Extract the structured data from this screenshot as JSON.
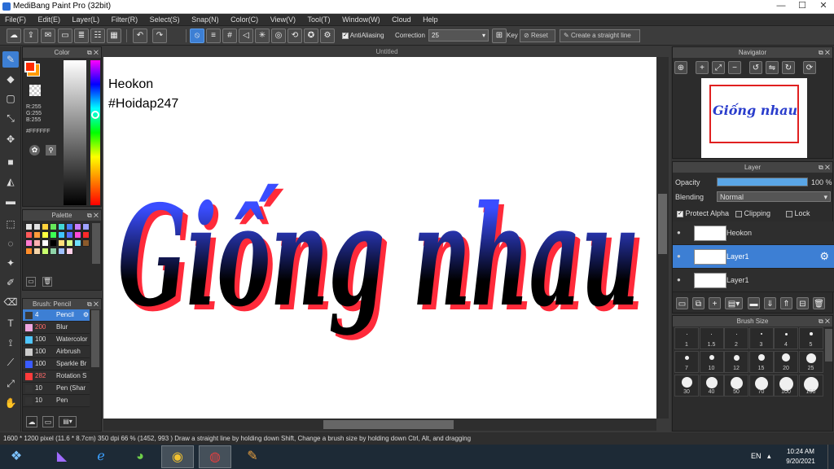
{
  "window": {
    "title": "MediBang Paint Pro (32bit)",
    "minimize": "—",
    "maximize": "☐",
    "close": "✕"
  },
  "menu": [
    "File(F)",
    "Edit(E)",
    "Layer(L)",
    "Filter(R)",
    "Select(S)",
    "Snap(N)",
    "Color(C)",
    "View(V)",
    "Tool(T)",
    "Window(W)",
    "Cloud",
    "Help"
  ],
  "toolbar": {
    "antialiasing_label": "AntiAliasing",
    "correction_label": "Correction",
    "correction_value": "25",
    "key_label": "Key",
    "reset_label": "Reset",
    "straight_line_placeholder": "Create a straight line"
  },
  "color_panel": {
    "title": "Color",
    "r": "R:255",
    "g": "G:255",
    "b": "B:255",
    "hex": "#FFFFFF",
    "primary": "#ff2a00",
    "secondary": "#ff9a00"
  },
  "palette": {
    "title": "Palette",
    "colors": [
      "#e6e6e6",
      "#e0e0e0",
      "#ffd23b",
      "#66e85a",
      "#42d6d6",
      "#4a7dff",
      "#c67cff",
      "#9ea2ff",
      "#ff5a5a",
      "#ff9c3b",
      "#ffff40",
      "#3cff54",
      "#3fc4ff",
      "#596bff",
      "#ff4ad8",
      "#ff2a2a",
      "#ff7ad0",
      "#ffb0b0",
      "#ffffff",
      "#000000",
      "#ffdf7a",
      "#d8ff8a",
      "#6fe0ff",
      "#8b5a2b",
      "#ff8e2a",
      "#f5d4a8",
      "#c9ff6e",
      "#8fd3a8",
      "#a0c0ff",
      "#ffd0e8"
    ]
  },
  "brush_panel": {
    "title": "Brush: Pencil",
    "brushes": [
      {
        "size": "4",
        "name": "Pencil",
        "color": "#3a3a3a",
        "selected": true
      },
      {
        "size": "200",
        "name": "Blur",
        "color": "#f0a6e0",
        "selected": false
      },
      {
        "size": "100",
        "name": "Watercolor",
        "color": "#4fc6ff",
        "selected": false
      },
      {
        "size": "100",
        "name": "Airbrush",
        "color": "#cccccc",
        "selected": false
      },
      {
        "size": "100",
        "name": "Sparkle Br",
        "color": "#3a5bff",
        "selected": false
      },
      {
        "size": "282",
        "name": "Rotation S",
        "color": "#ff3b3b",
        "selected": false
      },
      {
        "size": "10",
        "name": "Pen (Shar",
        "color": "#333333",
        "selected": false
      },
      {
        "size": "10",
        "name": "Pen",
        "color": "#333333",
        "selected": false
      }
    ]
  },
  "canvas": {
    "tab_title": "Untitled",
    "text_line1": "Heokon",
    "text_line2": "#Hoidap247",
    "artwork_text": "Giống nhau",
    "artwork_colors": {
      "top": "#3a4dff",
      "bottom": "#000000",
      "shadow": "#ff2a3a"
    }
  },
  "navigator": {
    "title": "Navigator",
    "preview_text": "Giống nhau"
  },
  "layer_panel": {
    "title": "Layer",
    "opacity_label": "Opacity",
    "opacity_value": "100 %",
    "opacity_fraction": 1.0,
    "blending_label": "Blending",
    "blending_value": "Normal",
    "protect_alpha_label": "Protect Alpha",
    "clipping_label": "Clipping",
    "lock_label": "Lock",
    "layers": [
      {
        "name": "Heokon",
        "selected": false
      },
      {
        "name": "Layer1",
        "selected": true
      },
      {
        "name": "Layer1",
        "selected": false
      }
    ]
  },
  "brush_size_panel": {
    "title": "Brush Size",
    "sizes": [
      "1",
      "1.5",
      "2",
      "3",
      "4",
      "5",
      "7",
      "10",
      "12",
      "15",
      "20",
      "25",
      "30",
      "40",
      "50",
      "70",
      "100",
      "150"
    ]
  },
  "status": {
    "dimensions": "1600 * 1200 pixel",
    "physical": "(11.6 * 8.7cm)",
    "dpi": "350 dpi",
    "zoom": "66 %",
    "coords": "(1452, 993 )",
    "hint": "Draw a straight line by holding down Shift, Change a brush size by holding down Ctrl, Alt, and dragging"
  },
  "taskbar": {
    "language": "EN",
    "time": "10:24 AM",
    "date": "9/20/2021"
  }
}
